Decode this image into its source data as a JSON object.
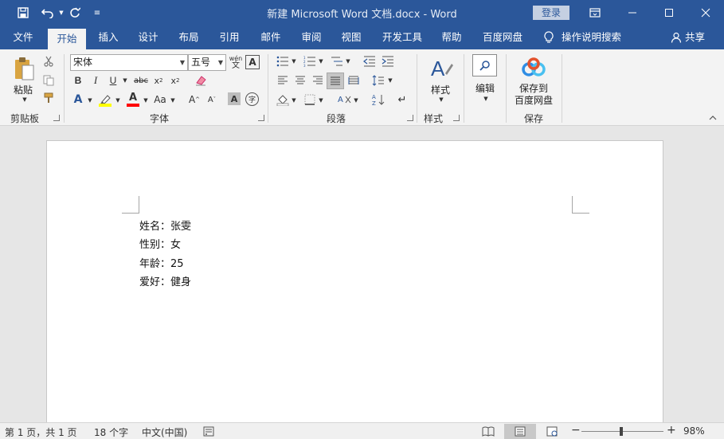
{
  "window": {
    "title": "新建 Microsoft Word 文档.docx  -  Word",
    "login_label": "登录",
    "controls": [
      "ribbon-display-icon",
      "minimize-icon",
      "maximize-icon",
      "close-icon"
    ]
  },
  "quick_access": [
    "save-icon",
    "undo-icon",
    "redo-icon",
    "customize-icon"
  ],
  "tabs": [
    "文件",
    "开始",
    "插入",
    "设计",
    "布局",
    "引用",
    "邮件",
    "审阅",
    "视图",
    "开发工具",
    "帮助",
    "百度网盘"
  ],
  "active_tab": "开始",
  "tell_me": "操作说明搜索",
  "share": "共享",
  "ribbon": {
    "clipboard": {
      "paste": "粘贴",
      "label": "剪贴板"
    },
    "font": {
      "font_name": "宋体",
      "font_size": "五号",
      "label": "字体"
    },
    "paragraph": {
      "label": "段落"
    },
    "styles": {
      "button": "样式",
      "label": "样式"
    },
    "editing": {
      "button": "编辑"
    },
    "save": {
      "button_line1": "保存到",
      "button_line2": "百度网盘",
      "label": "保存"
    }
  },
  "document": {
    "lines": [
      "姓名：张雯",
      "性别：女",
      "年龄：25",
      "爱好：健身"
    ]
  },
  "status": {
    "page": "第 1 页，共 1 页",
    "words": "18 个字",
    "language": "中文(中国)",
    "zoom_minus": "−",
    "zoom_plus": "+",
    "zoom": "98%",
    "zoom_level": 0.49
  },
  "colors": {
    "brand": "#2b579a",
    "highlight": "#ffff00",
    "font_color": "#ff0000"
  }
}
